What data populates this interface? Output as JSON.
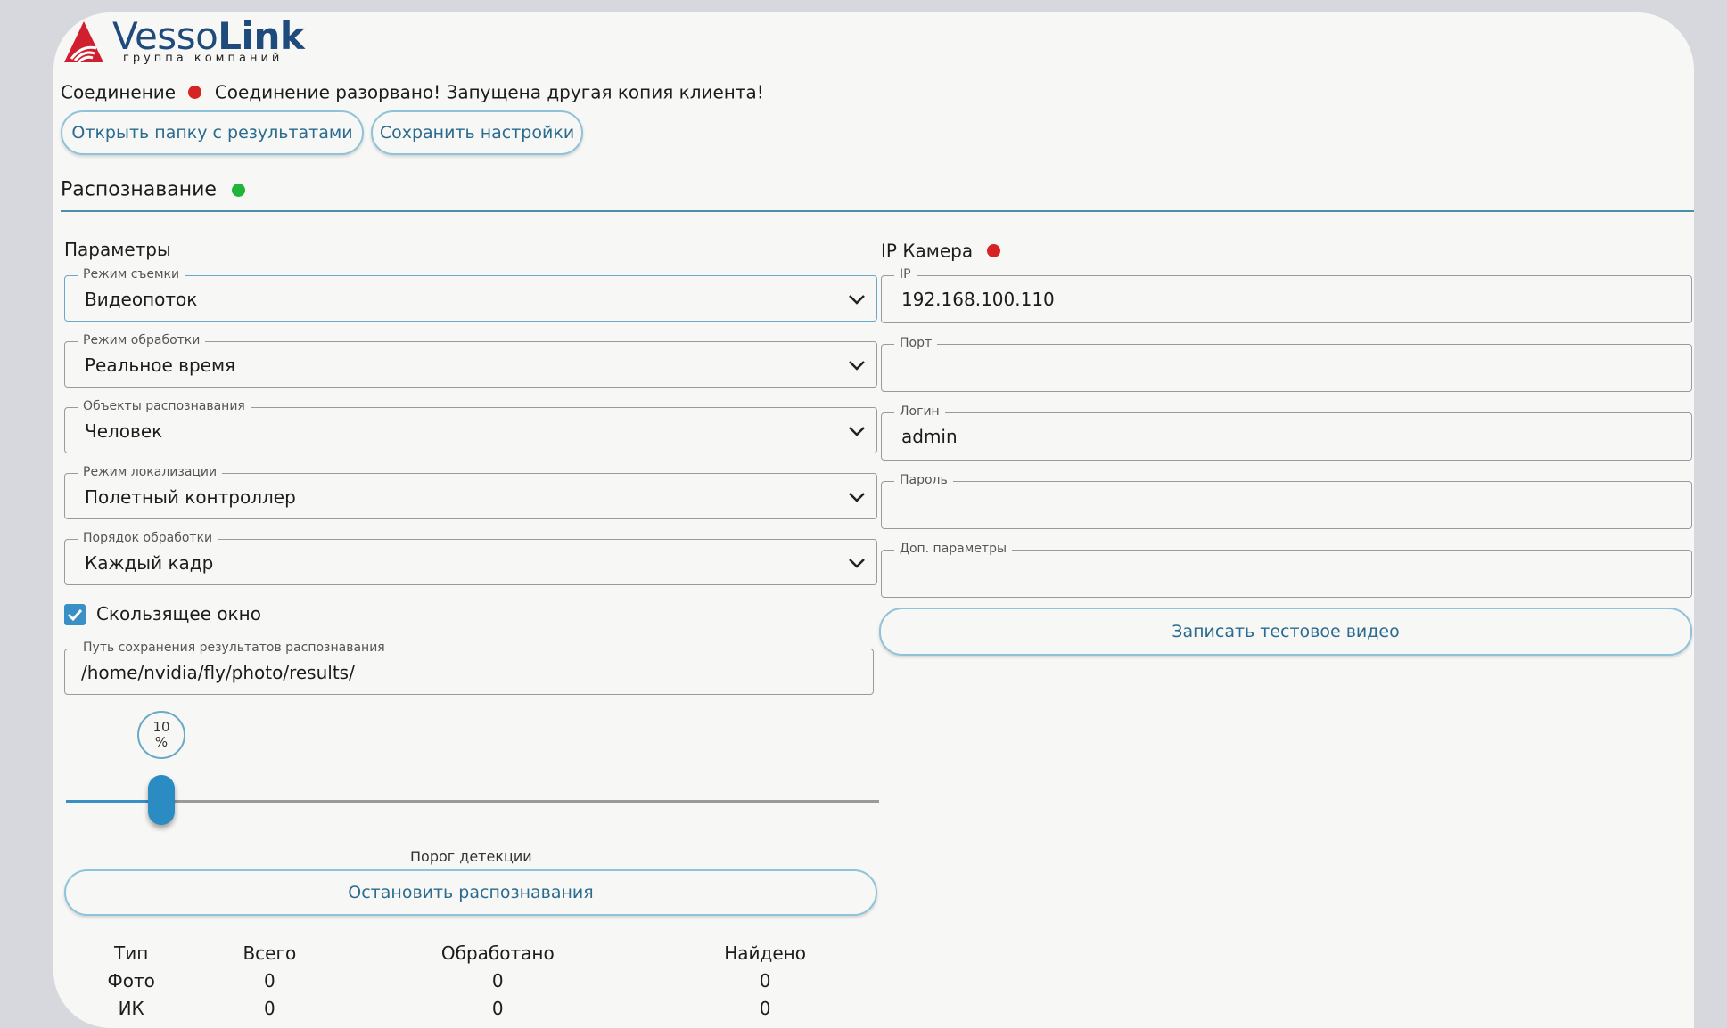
{
  "brand": {
    "name_light": "Vesso",
    "name_bold": "Link",
    "subtitle": "группа компаний"
  },
  "connection": {
    "label": "Соединение",
    "status_color": "#d62323",
    "message": "Соединение разорвано! Запущена другая копия клиента!"
  },
  "toolbar": {
    "open_folder_label": "Открыть папку с результатами",
    "save_settings_label": "Сохранить настройки"
  },
  "recognition": {
    "title": "Распознавание",
    "status_color": "#22b43a"
  },
  "params": {
    "title": "Параметры",
    "shooting_mode": {
      "label": "Режим съемки",
      "value": "Видеопоток"
    },
    "processing_mode": {
      "label": "Режим обработки",
      "value": "Реальное время"
    },
    "objects": {
      "label": "Объекты распознавания",
      "value": "Человек"
    },
    "localization_mode": {
      "label": "Режим локализации",
      "value": "Полетный контроллер"
    },
    "processing_order": {
      "label": "Порядок обработки",
      "value": "Каждый кадр"
    },
    "sliding_window": {
      "label": "Скользящее окно",
      "checked": true
    },
    "save_path": {
      "label": "Путь сохранения результатов распознавания",
      "value": "/home/nvidia/fly/photo/results/"
    },
    "threshold": {
      "value": 10,
      "unit": "%",
      "caption": "Порог детекции"
    },
    "stop_button_label": "Остановить распознавания"
  },
  "camera": {
    "title": "IP Камера",
    "status_color": "#d62323",
    "ip": {
      "label": "IP",
      "value": "192.168.100.110"
    },
    "port": {
      "label": "Порт",
      "value": ""
    },
    "login": {
      "label": "Логин",
      "value": "admin"
    },
    "password": {
      "label": "Пароль",
      "value": ""
    },
    "extra": {
      "label": "Доп. параметры",
      "value": ""
    },
    "record_button_label": "Записать тестовое видео"
  },
  "stats": {
    "headers": [
      "Тип",
      "Всего",
      "Обработано",
      "Найдено"
    ],
    "rows": [
      [
        "Фото",
        "0",
        "0",
        "0"
      ],
      [
        "ИК",
        "0",
        "0",
        "0"
      ]
    ]
  }
}
